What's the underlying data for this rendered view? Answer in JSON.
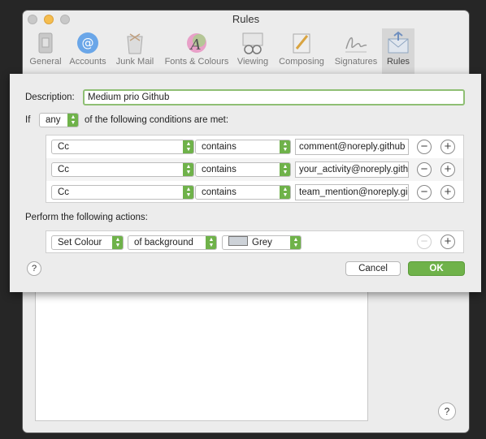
{
  "window": {
    "title": "Rules"
  },
  "toolbar": {
    "items": [
      {
        "label": "General",
        "icon": "general-icon"
      },
      {
        "label": "Accounts",
        "icon": "accounts-icon"
      },
      {
        "label": "Junk Mail",
        "icon": "junk-mail-icon"
      },
      {
        "label": "Fonts & Colours",
        "icon": "fonts-colours-icon"
      },
      {
        "label": "Viewing",
        "icon": "viewing-icon"
      },
      {
        "label": "Composing",
        "icon": "composing-icon"
      },
      {
        "label": "Signatures",
        "icon": "signatures-icon"
      },
      {
        "label": "Rules",
        "icon": "rules-icon"
      }
    ],
    "active": "Rules"
  },
  "sheet": {
    "description_label": "Description:",
    "description_value": "Medium prio Github",
    "if_label": "If",
    "match_mode": "any",
    "conditions_suffix": "of the following conditions are met:",
    "conditions": [
      {
        "field": "Cc",
        "operator": "contains",
        "value": "comment@noreply.github"
      },
      {
        "field": "Cc",
        "operator": "contains",
        "value": "your_activity@noreply.gith"
      },
      {
        "field": "Cc",
        "operator": "contains",
        "value": "team_mention@noreply.gi"
      }
    ],
    "actions_label": "Perform the following actions:",
    "action": {
      "type": "Set Colour",
      "target": "of background",
      "colour": "Grey",
      "colour_hex": "#cdd2d8"
    },
    "help": "?",
    "cancel": "Cancel",
    "ok": "OK"
  },
  "background": {
    "help": "?"
  },
  "colors": {
    "accent_green": "#6fb24a"
  }
}
